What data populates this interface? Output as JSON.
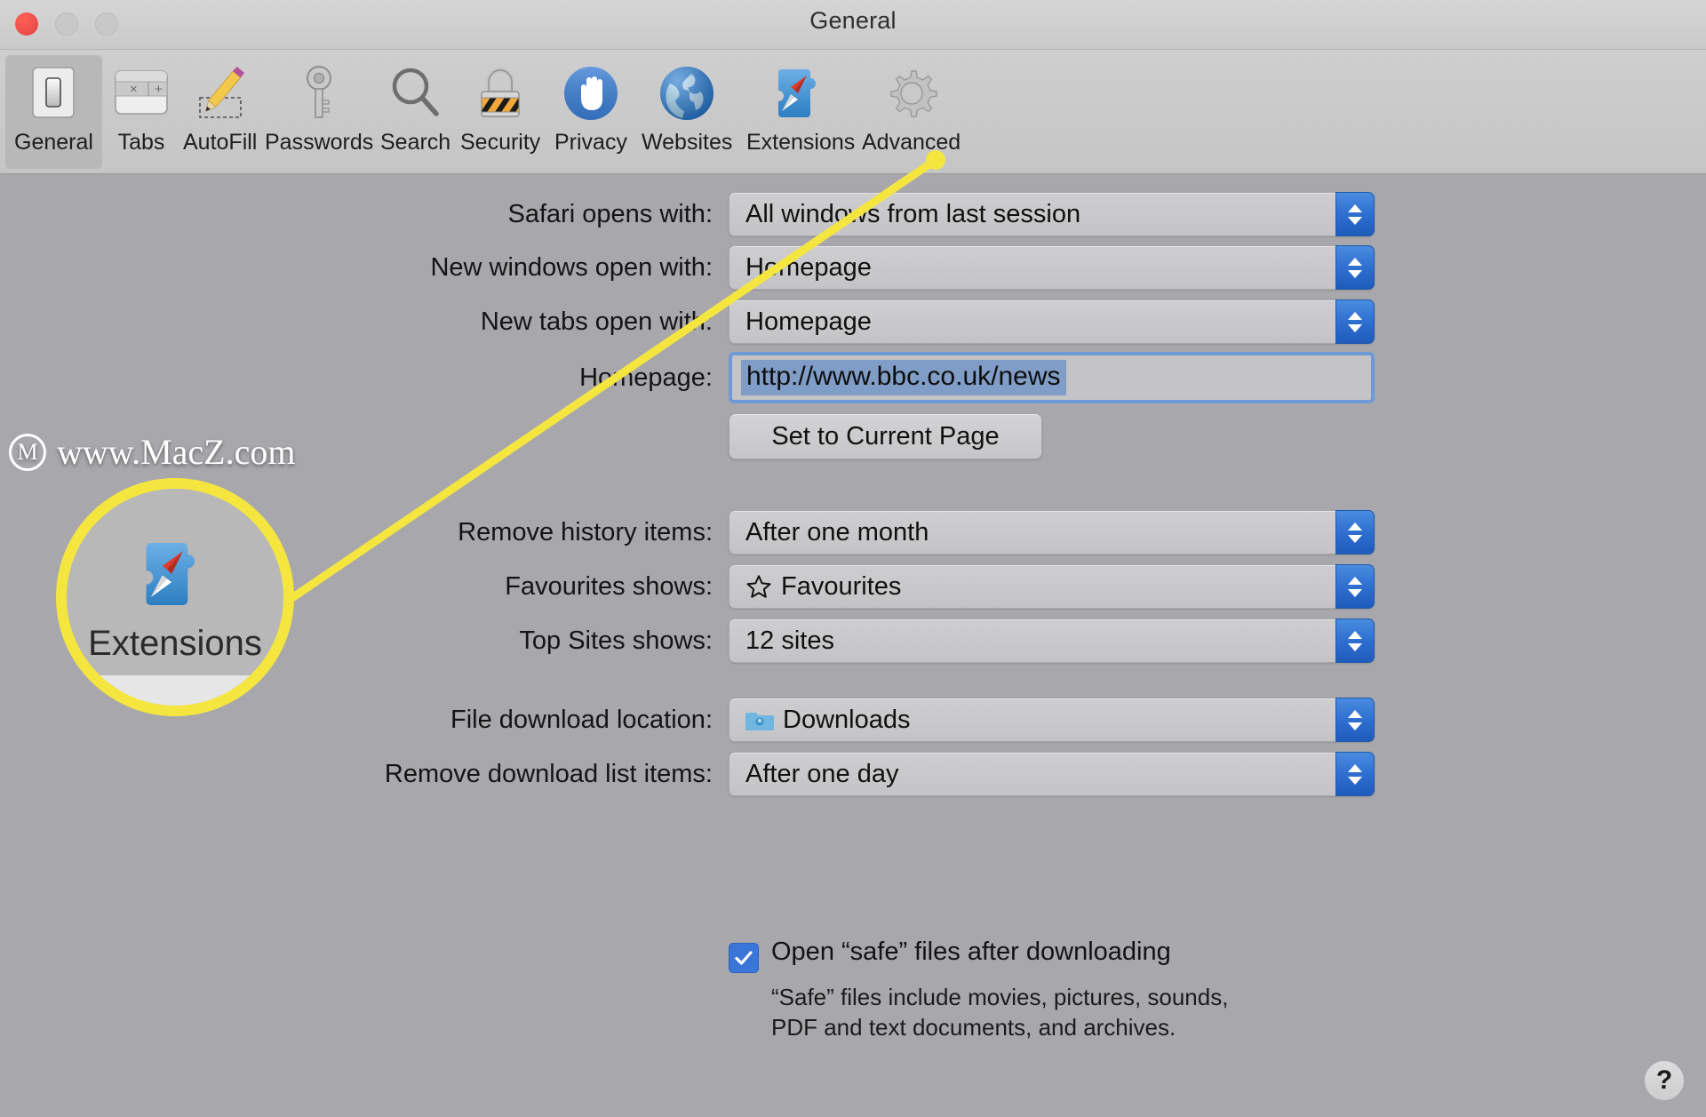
{
  "window": {
    "title": "General",
    "traffic_lights": [
      "close",
      "minimize",
      "maximize"
    ]
  },
  "toolbar": {
    "items": [
      {
        "label": "General",
        "icon": "general-switch-icon",
        "selected": true
      },
      {
        "label": "Tabs",
        "icon": "tabs-icon",
        "selected": false
      },
      {
        "label": "AutoFill",
        "icon": "pencil-icon",
        "selected": false
      },
      {
        "label": "Passwords",
        "icon": "key-icon",
        "selected": false
      },
      {
        "label": "Search",
        "icon": "magnifier-icon",
        "selected": false
      },
      {
        "label": "Security",
        "icon": "padlock-icon",
        "selected": false
      },
      {
        "label": "Privacy",
        "icon": "hand-icon",
        "selected": false
      },
      {
        "label": "Websites",
        "icon": "globe-icon",
        "selected": false
      },
      {
        "label": "Extensions",
        "icon": "puzzle-compass-icon",
        "selected": false
      },
      {
        "label": "Advanced",
        "icon": "gear-icon",
        "selected": false
      }
    ]
  },
  "form": {
    "safari_opens_with": {
      "label": "Safari opens with:",
      "value": "All windows from last session"
    },
    "new_windows_open_with": {
      "label": "New windows open with:",
      "value": "Homepage"
    },
    "new_tabs_open_with": {
      "label": "New tabs open with:",
      "value": "Homepage"
    },
    "homepage": {
      "label": "Homepage:",
      "value": "http://www.bbc.co.uk/news"
    },
    "set_to_current_page": {
      "label": "Set to Current Page"
    },
    "remove_history_items": {
      "label": "Remove history items:",
      "value": "After one month"
    },
    "favourites_shows": {
      "label": "Favourites shows:",
      "value": "Favourites",
      "icon": "star-icon"
    },
    "top_sites_shows": {
      "label": "Top Sites shows:",
      "value": "12 sites"
    },
    "file_download_location": {
      "label": "File download location:",
      "value": "Downloads",
      "icon": "folder-icon"
    },
    "remove_download_items": {
      "label": "Remove download list items:",
      "value": "After one day"
    },
    "open_safe_files": {
      "label": "Open “safe” files after downloading",
      "checked": true
    },
    "open_safe_files_note": "“Safe” files include movies, pictures, sounds, PDF and text documents, and archives."
  },
  "help": {
    "label": "?"
  },
  "callout": {
    "circle_label": "Extensions",
    "icon": "puzzle-compass-icon",
    "line_color": "#f5e63f",
    "ring_color": "#f5e63f"
  },
  "watermark": {
    "text": "www.MacZ.com",
    "logo_letter": "M"
  },
  "colors": {
    "window_bg": "#a8a8ac",
    "toolbar_bg": "#cbcacb",
    "accent_blue": "#2f6fd0",
    "selection_blue": "#7f9dc6",
    "checkbox_blue": "#3a76d8",
    "highlight_yellow": "#f5e63f"
  }
}
